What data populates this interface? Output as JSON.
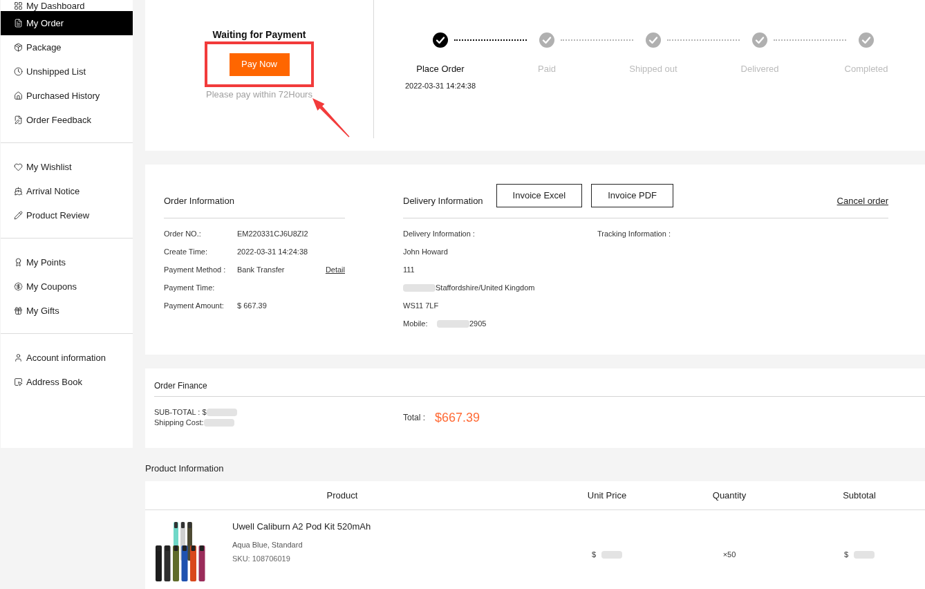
{
  "sidebar": {
    "groups": [
      {
        "items": [
          {
            "label": "My Dashboard",
            "selected": false
          },
          {
            "label": "My Order",
            "selected": true
          },
          {
            "label": "Package",
            "selected": false
          },
          {
            "label": "Unshipped List",
            "selected": false
          },
          {
            "label": "Purchased History",
            "selected": false
          },
          {
            "label": "Order Feedback",
            "selected": false
          }
        ]
      },
      {
        "items": [
          {
            "label": "My Wishlist",
            "selected": false
          },
          {
            "label": "Arrival Notice",
            "selected": false
          },
          {
            "label": "Product Review",
            "selected": false
          }
        ]
      },
      {
        "items": [
          {
            "label": "My Points",
            "selected": false
          },
          {
            "label": "My Coupons",
            "selected": false
          },
          {
            "label": "My Gifts",
            "selected": false
          }
        ]
      },
      {
        "items": [
          {
            "label": "Account information",
            "selected": false
          },
          {
            "label": "Address Book",
            "selected": false
          }
        ]
      }
    ]
  },
  "order_status": {
    "title": "Waiting for Payment",
    "button": "Pay Now",
    "note": "Please pay within 72Hours"
  },
  "progress_steps": [
    {
      "label": "Place Order",
      "date": "2022-03-31 14:24:38",
      "done": true
    },
    {
      "label": "Paid",
      "done": false
    },
    {
      "label": "Shipped out",
      "done": false
    },
    {
      "label": "Delivered",
      "done": false
    },
    {
      "label": "Completed",
      "done": false
    }
  ],
  "order_information": {
    "title": "Order Information",
    "rows": [
      {
        "label": "Order NO.:",
        "value": "EM220331CJ6U8ZI2"
      },
      {
        "label": "Create Time:",
        "value": "2022-03-31 14:24:38"
      },
      {
        "label": "Payment Method :",
        "value": "Bank Transfer",
        "link": "Detail"
      },
      {
        "label": "Payment Time:"
      },
      {
        "label": "Payment Amount:",
        "value": "$ 667.39"
      }
    ]
  },
  "delivery_information": {
    "title": "Delivery Information",
    "buttons": [
      "Invoice Excel",
      "Invoice PDF"
    ],
    "cancel_link": "Cancel order",
    "address_label": "Delivery Information :",
    "lines": [
      {
        "text": "John Howard",
        "redacted": false
      },
      {
        "text": "111",
        "redacted": false
      },
      {
        "text": "Staffordshire/United Kingdom",
        "redacted": true
      },
      {
        "text": "WS11 7LF",
        "redacted": false
      },
      {
        "label": "Mobile:",
        "text": "2905",
        "redacted": true
      }
    ],
    "tracking_label": "Tracking Information :"
  },
  "order_finance": {
    "title": "Order Finance",
    "lines": [
      {
        "label": "SUB-TOTAL : $",
        "redacted": true
      },
      {
        "label": "Shipping Cost:",
        "redacted": true
      }
    ],
    "total_label": "Total :",
    "total": "$667.39"
  },
  "product_information": {
    "title": "Product Information",
    "columns": [
      "Product",
      "Unit Price",
      "Quantity",
      "Subtotal"
    ],
    "rows": [
      {
        "name": "Uwell Caliburn A2 Pod Kit 520mAh",
        "variant": "Aqua Blue, Standard",
        "sku": "SKU: 108706019",
        "unit_price": {
          "text": "$",
          "redacted": true
        },
        "quantity": "×50",
        "subtotal": {
          "text": "$",
          "redacted": true
        }
      }
    ]
  }
}
